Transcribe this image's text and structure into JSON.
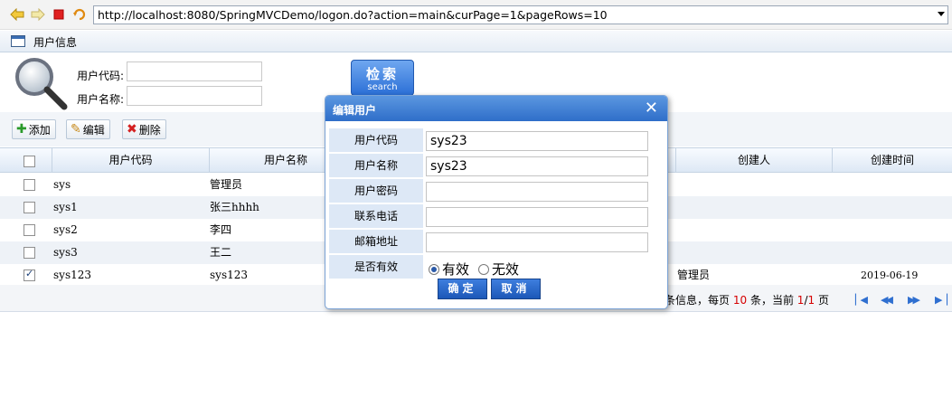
{
  "browser": {
    "url": "http://localhost:8080/SpringMVCDemo/logon.do?action=main&curPage=1&pageRows=10"
  },
  "panel": {
    "title": "用户信息"
  },
  "search": {
    "user_code_label": "用户代码:",
    "user_name_label": "用户名称:",
    "user_code_value": "",
    "user_name_value": "",
    "button_main": "检索",
    "button_sub": "search"
  },
  "toolbar": {
    "add_label": "添加",
    "edit_label": "编辑",
    "delete_label": "删除"
  },
  "grid": {
    "headers": [
      "用户代码",
      "用户名称",
      "创建人",
      "创建时间"
    ],
    "rows": [
      {
        "code": "sys",
        "name": "管理员",
        "creator": "",
        "created": "",
        "checked": false
      },
      {
        "code": "sys1",
        "name": "张三hhhh",
        "creator": "",
        "created": "",
        "checked": false
      },
      {
        "code": "sys2",
        "name": "李四",
        "creator": "",
        "created": "",
        "checked": false
      },
      {
        "code": "sys3",
        "name": "王二",
        "creator": "",
        "created": "",
        "checked": false
      },
      {
        "code": "sys123",
        "name": "sys123",
        "creator": "管理员",
        "created": "2019-06-19 00:00:00",
        "checked": true
      }
    ]
  },
  "pager": {
    "prefix": "条信息，每页",
    "page_rows": "10",
    "mid": "条，当前",
    "current": "1",
    "sep": "/",
    "total": "1",
    "suffix": "页"
  },
  "dialog": {
    "title": "编辑用户",
    "fields": [
      {
        "label": "用户代码",
        "value": "sys23"
      },
      {
        "label": "用户名称",
        "value": "sys23"
      },
      {
        "label": "用户密码",
        "value": ""
      },
      {
        "label": "联系电话",
        "value": ""
      },
      {
        "label": "邮箱地址",
        "value": ""
      }
    ],
    "valid_label": "是否有效",
    "valid_yes": "有效",
    "valid_no": "无效",
    "valid_selected": "有效",
    "confirm_label": "确定",
    "cancel_label": "取消"
  },
  "colors": {
    "accent": "#2f6ec9",
    "pager_highlight": "#d60000"
  }
}
